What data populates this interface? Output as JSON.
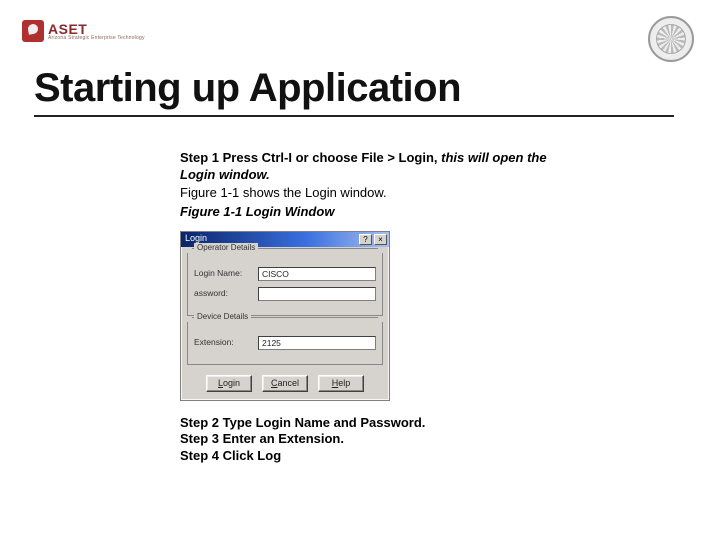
{
  "brand": {
    "name": "ASET",
    "tagline": "Arizona Strategic Enterprise Technology"
  },
  "title": "Starting up Application",
  "step1": {
    "prefix": "Step 1 Press Ctrl-I or choose File > Login,",
    "suffix": " this will open the Login window.",
    "note": "Figure 1-1 shows the Login window.",
    "caption": "Figure 1-1 Login Window"
  },
  "dialog": {
    "title": "Login",
    "help_btn": "?",
    "close_btn": "×",
    "group_operator": "Operator Details",
    "label_login": "Login Name:",
    "value_login": "CISCO",
    "label_password": "assword:",
    "value_password": "",
    "group_device": "Device Details",
    "label_ext": "Extension:",
    "value_ext": "2125",
    "btn_login": "ogin",
    "btn_login_u": "L",
    "btn_cancel_u": "C",
    "btn_cancel": "ancel",
    "btn_help_u": "H",
    "btn_help": "elp"
  },
  "steps_tail": {
    "s2": "Step 2 Type Login Name and Password.",
    "s3": "Step 3 Enter an Extension.",
    "s4": "Step 4 Click Log"
  }
}
